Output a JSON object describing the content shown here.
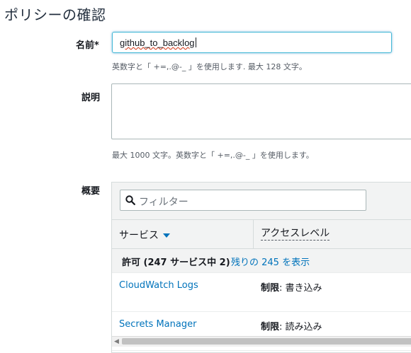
{
  "page": {
    "title": "ポリシーの確認"
  },
  "name_field": {
    "label": "名前*",
    "value": "github_to_backlog",
    "hint": "英数字と「 +=,.@-_ 」を使用します. 最大 128 文字。"
  },
  "description_field": {
    "label": "説明",
    "value": "",
    "hint": "最大 1000 文字。英数字と「 +=,.@-_ 」を使用します。"
  },
  "summary": {
    "label": "概要",
    "filter_placeholder": "フィルター",
    "columns": {
      "service": "サービス",
      "access_level": "アクセスレベル"
    },
    "group": {
      "label": "許可 (247 サービス中 2)",
      "show_more_link": "残りの 245 を表示"
    },
    "rows": [
      {
        "service": "CloudWatch Logs",
        "access_prefix": "制限",
        "access_value": ": 書き込み"
      },
      {
        "service": "Secrets Manager",
        "access_prefix": "制限",
        "access_value": ": 読み込み"
      }
    ]
  },
  "colors": {
    "link": "#0073bb",
    "input_focus_border": "#44b9d6",
    "spellcheck_underline": "#d13212",
    "header_bg": "#f2f3f3"
  },
  "icons": {
    "filter": "search-icon",
    "sort": "caret-down-icon",
    "scroll_left": "scroll-left-arrow-icon"
  }
}
